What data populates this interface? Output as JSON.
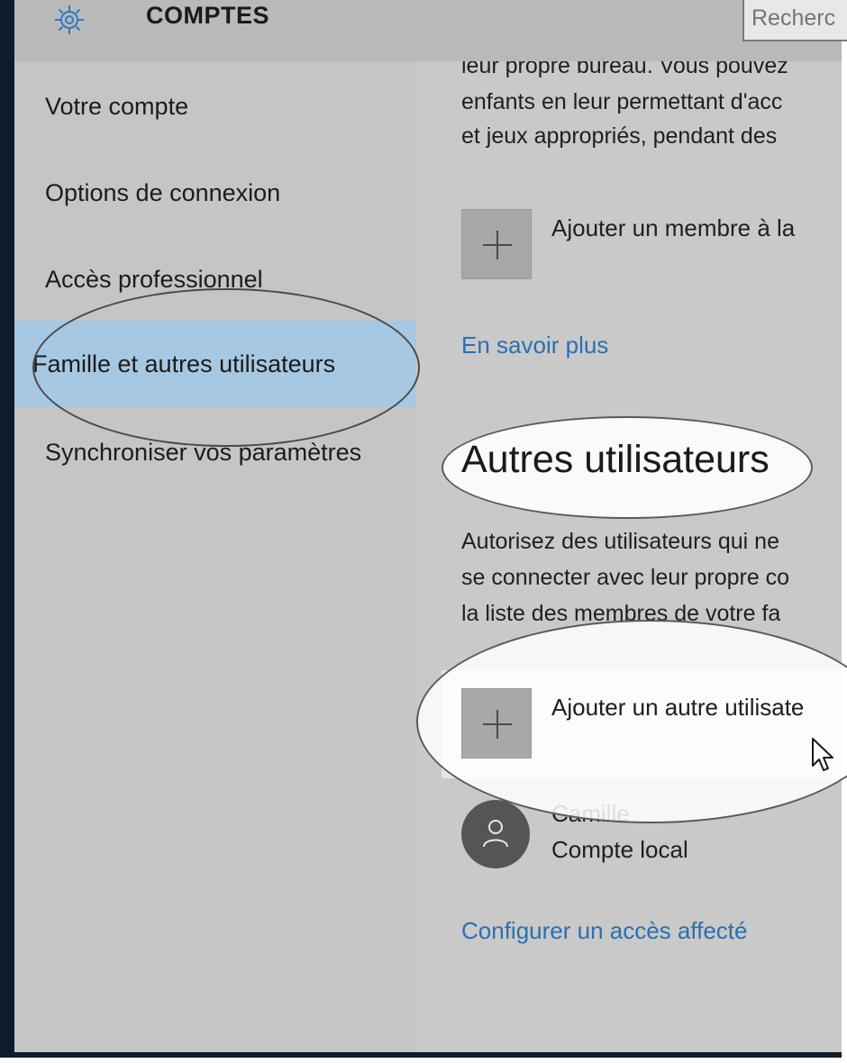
{
  "window": {
    "title": "COMPTES",
    "icon": "gear-icon",
    "search_placeholder": "Recherc"
  },
  "sidebar": {
    "items": [
      {
        "label": "Votre compte",
        "selected": false
      },
      {
        "label": "Options de connexion",
        "selected": false
      },
      {
        "label": "Accès professionnel",
        "selected": false
      },
      {
        "label": "Famille et autres utilisateurs",
        "selected": true
      },
      {
        "label": "Synchroniser vos paramètres",
        "selected": false
      }
    ]
  },
  "content": {
    "family_text": {
      "line1": "leur propre bureau. Vous pouvez",
      "line2": "enfants en leur permettant d'acc",
      "line3": "et jeux appropriés, pendant des"
    },
    "add_family_member_label": "Ajouter un membre à la",
    "learn_more_link": "En savoir plus",
    "other_users_heading": "Autres utilisateurs",
    "other_users_text": {
      "line1": "Autorisez des utilisateurs qui ne",
      "line2": "se connecter avec leur propre co",
      "line3": "la liste des membres de votre fa"
    },
    "add_other_user_label": "Ajouter un autre utilisate",
    "user": {
      "name": "Camille",
      "type": "Compte local",
      "icon": "person-icon"
    },
    "assigned_access_link": "Configurer un accès affecté"
  },
  "colors": {
    "titlebar": "#b9b9b9",
    "sidebar": "#c5c5c5",
    "content": "#c9c9c9",
    "selected": "#a6c8e2",
    "link": "#2c6fb0",
    "frame": "#0e1b2b"
  }
}
